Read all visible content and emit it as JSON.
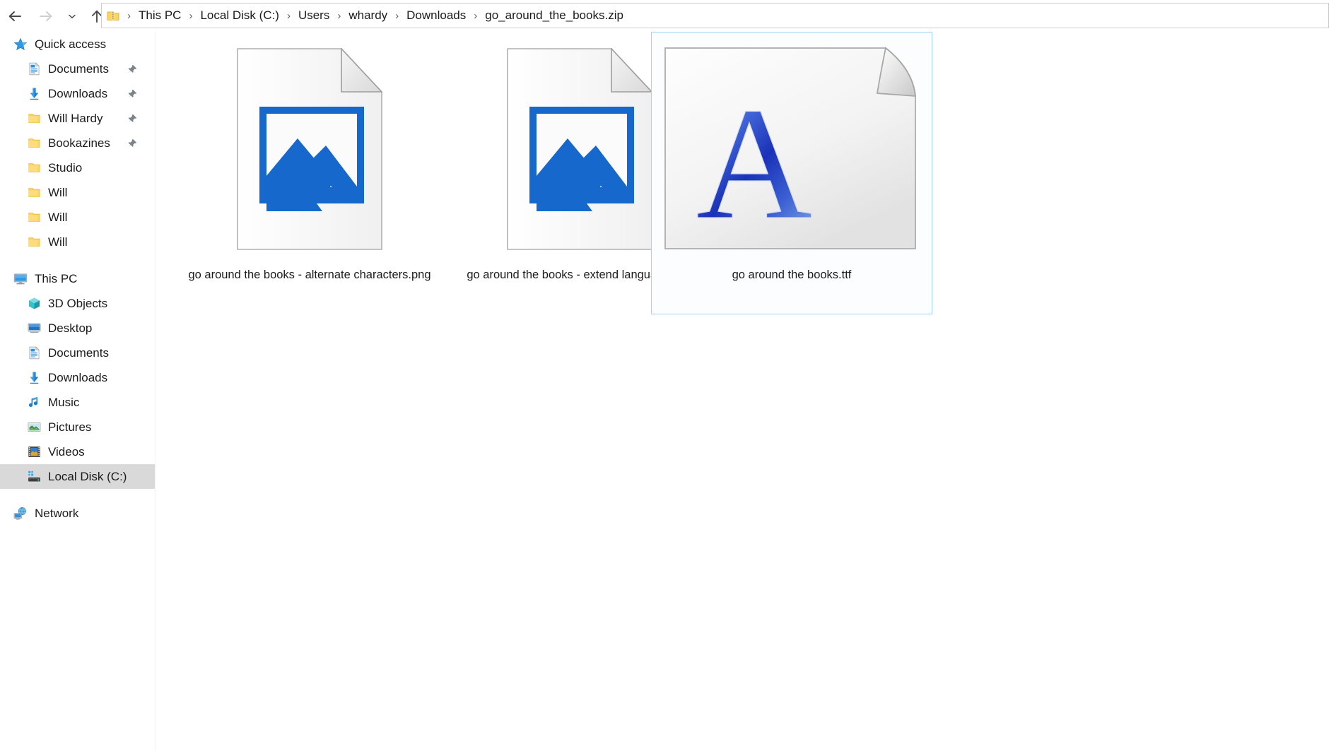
{
  "window": {
    "app": "File Explorer",
    "path_title": "go_around_the_books.zip"
  },
  "toolbar": {
    "back": {
      "name": "Back",
      "icon": "back-arrow-icon",
      "enabled": true
    },
    "forward": {
      "name": "Forward",
      "icon": "forward-arrow-icon",
      "enabled": false
    },
    "recent": {
      "name": "Recent locations",
      "icon": "chevron-down-icon",
      "enabled": true
    },
    "up": {
      "name": "Up",
      "icon": "up-arrow-icon",
      "enabled": true
    }
  },
  "breadcrumb": {
    "icon": "zip-folder-icon",
    "separator": "›",
    "crumbs": [
      "This PC",
      "Local Disk (C:)",
      "Users",
      "whardy",
      "Downloads",
      "go_around_the_books.zip"
    ]
  },
  "sidebar": {
    "groups": [
      {
        "name": "quick-access",
        "items": [
          {
            "label": "Quick access",
            "icon": "star-icon",
            "level": 0,
            "pinned": false,
            "selected": false
          },
          {
            "label": "Documents",
            "icon": "documents-icon",
            "level": 1,
            "pinned": true,
            "selected": false
          },
          {
            "label": "Downloads",
            "icon": "downloads-icon",
            "level": 1,
            "pinned": true,
            "selected": false
          },
          {
            "label": "Will Hardy",
            "icon": "folder-icon",
            "level": 1,
            "pinned": true,
            "selected": false
          },
          {
            "label": "Bookazines",
            "icon": "folder-icon",
            "level": 1,
            "pinned": true,
            "selected": false
          },
          {
            "label": "Studio",
            "icon": "folder-icon",
            "level": 1,
            "pinned": false,
            "selected": false
          },
          {
            "label": "Will",
            "icon": "folder-icon",
            "level": 1,
            "pinned": false,
            "selected": false
          },
          {
            "label": "Will",
            "icon": "folder-icon",
            "level": 1,
            "pinned": false,
            "selected": false
          },
          {
            "label": "Will",
            "icon": "folder-icon",
            "level": 1,
            "pinned": false,
            "selected": false
          }
        ]
      },
      {
        "name": "this-pc",
        "items": [
          {
            "label": "This PC",
            "icon": "monitor-icon",
            "level": 0,
            "pinned": false,
            "selected": false
          },
          {
            "label": "3D Objects",
            "icon": "cube-icon",
            "level": 1,
            "pinned": false,
            "selected": false
          },
          {
            "label": "Desktop",
            "icon": "desktop-icon",
            "level": 1,
            "pinned": false,
            "selected": false
          },
          {
            "label": "Documents",
            "icon": "documents-icon",
            "level": 1,
            "pinned": false,
            "selected": false
          },
          {
            "label": "Downloads",
            "icon": "downloads-icon",
            "level": 1,
            "pinned": false,
            "selected": false
          },
          {
            "label": "Music",
            "icon": "music-note-icon",
            "level": 1,
            "pinned": false,
            "selected": false
          },
          {
            "label": "Pictures",
            "icon": "pictures-icon",
            "level": 1,
            "pinned": false,
            "selected": false
          },
          {
            "label": "Videos",
            "icon": "videos-icon",
            "level": 1,
            "pinned": false,
            "selected": false
          },
          {
            "label": "Local Disk (C:)",
            "icon": "hard-drive-icon",
            "level": 1,
            "pinned": false,
            "selected": true
          }
        ]
      },
      {
        "name": "network",
        "items": [
          {
            "label": "Network",
            "icon": "network-icon",
            "level": 0,
            "pinned": false,
            "selected": false
          }
        ]
      }
    ]
  },
  "files": [
    {
      "label": "go around the books - alternate characters.png",
      "icon": "png-image-file-icon",
      "selected": false
    },
    {
      "label": "go around the books - extend language.png",
      "icon": "png-image-file-icon",
      "selected": false
    },
    {
      "label": "go around the books.ttf",
      "icon": "ttf-font-file-icon",
      "selected": true
    }
  ],
  "colors": {
    "image_icon_blue": "#1668cc",
    "font_glyph_blue": "#2c43c7",
    "selection_border": "#a5d3f3",
    "selection_fill": "#fcfdff",
    "sidebar_selected": "#d9d9d9",
    "folder_yellow": "#ffd966",
    "text": "#1b1b1b"
  }
}
